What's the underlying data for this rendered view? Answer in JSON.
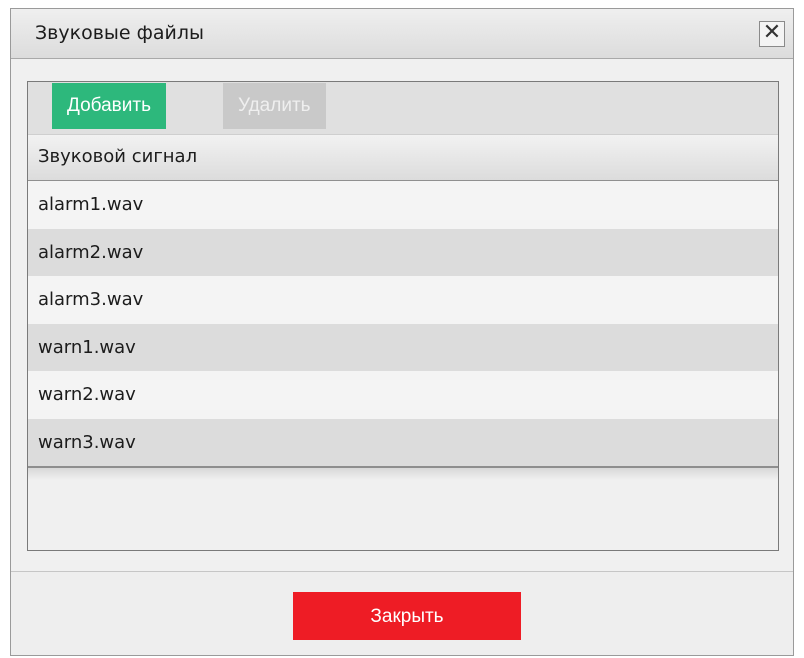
{
  "window": {
    "title": "Звуковые файлы",
    "close_icon": "close-icon",
    "close_glyph": "✕"
  },
  "toolbar": {
    "add_label": "Добавить",
    "delete_label": "Удалить"
  },
  "table": {
    "column_header": "Звуковой сигнал",
    "rows": [
      "alarm1.wav",
      "alarm2.wav",
      "alarm3.wav",
      "warn1.wav",
      "warn2.wav",
      "warn3.wav"
    ]
  },
  "footer": {
    "close_label": "Закрыть"
  },
  "colors": {
    "add_button": "#2db87c",
    "delete_button_disabled": "#c9c9c9",
    "close_button": "#ee1c25"
  }
}
